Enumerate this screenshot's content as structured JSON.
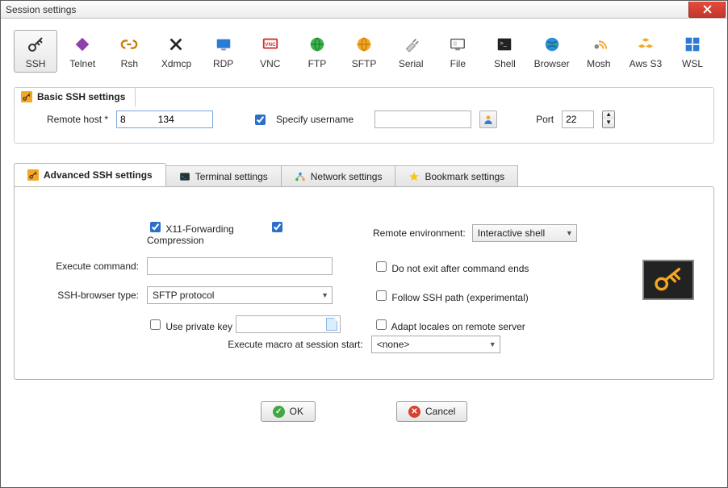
{
  "window": {
    "title": "Session settings"
  },
  "protocols": [
    {
      "id": "ssh",
      "label": "SSH"
    },
    {
      "id": "telnet",
      "label": "Telnet"
    },
    {
      "id": "rsh",
      "label": "Rsh"
    },
    {
      "id": "xdmcp",
      "label": "Xdmcp"
    },
    {
      "id": "rdp",
      "label": "RDP"
    },
    {
      "id": "vnc",
      "label": "VNC"
    },
    {
      "id": "ftp",
      "label": "FTP"
    },
    {
      "id": "sftp",
      "label": "SFTP"
    },
    {
      "id": "serial",
      "label": "Serial"
    },
    {
      "id": "file",
      "label": "File"
    },
    {
      "id": "shell",
      "label": "Shell"
    },
    {
      "id": "browser",
      "label": "Browser"
    },
    {
      "id": "mosh",
      "label": "Mosh"
    },
    {
      "id": "awss3",
      "label": "Aws S3"
    },
    {
      "id": "wsl",
      "label": "WSL"
    }
  ],
  "basic": {
    "group_title": "Basic SSH settings",
    "remote_host_label": "Remote host *",
    "remote_host_value": "8            134",
    "specify_username_label": "Specify username",
    "specify_username_checked": true,
    "username_value": "",
    "port_label": "Port",
    "port_value": "22"
  },
  "adv_tabs": {
    "advanced": "Advanced SSH settings",
    "terminal": "Terminal settings",
    "network": "Network settings",
    "bookmark": "Bookmark settings"
  },
  "advanced": {
    "x11_label": "X11-Forwarding",
    "x11_checked": true,
    "compression_label": "Compression",
    "compression_checked": true,
    "remote_env_label": "Remote environment:",
    "remote_env_value": "Interactive shell",
    "exec_cmd_label": "Execute command:",
    "exec_cmd_value": "",
    "no_exit_label": "Do not exit after command ends",
    "no_exit_checked": false,
    "browser_type_label": "SSH-browser type:",
    "browser_type_value": "SFTP protocol",
    "follow_path_label": "Follow SSH path (experimental)",
    "follow_path_checked": false,
    "private_key_label": "Use private key",
    "private_key_checked": false,
    "private_key_value": "",
    "adapt_locales_label": "Adapt locales on remote server",
    "adapt_locales_checked": false,
    "macro_label": "Execute macro at session start:",
    "macro_value": "<none>"
  },
  "buttons": {
    "ok": "OK",
    "cancel": "Cancel"
  }
}
